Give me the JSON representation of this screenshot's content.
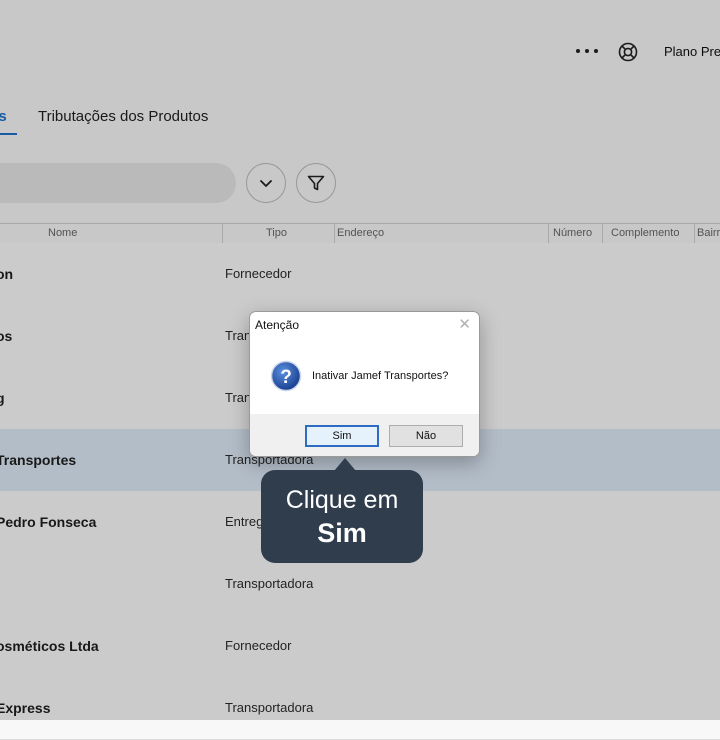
{
  "header": {
    "plan_label": "Plano Pre"
  },
  "tabs": [
    {
      "label": "es",
      "active": true
    },
    {
      "label": "Tributações dos Produtos",
      "active": false
    }
  ],
  "table": {
    "columns": [
      "Nome",
      "Tipo",
      "Endereço",
      "Número",
      "Complemento",
      "Bairr"
    ],
    "rows": [
      {
        "name": "on",
        "type": "Fornecedor",
        "selected": false
      },
      {
        "name": "os",
        "type": "Tran",
        "selected": false
      },
      {
        "name": "g",
        "type": "Tran",
        "selected": false
      },
      {
        "name": " Transportes",
        "type": "Transportadora",
        "selected": true
      },
      {
        "name": "Pedro Fonseca",
        "type": "Entreg",
        "selected": false
      },
      {
        "name": "",
        "type": "Transportadora",
        "selected": false
      },
      {
        "name": "osméticos Ltda",
        "type": "Fornecedor",
        "selected": false
      },
      {
        "name": "Express",
        "type": "Transportadora",
        "selected": false
      }
    ]
  },
  "dialog": {
    "title": "Atenção",
    "close_glyph": "✕",
    "message": "Inativar Jamef Transportes?",
    "yes_label": "Sim",
    "no_label": "Não"
  },
  "callout": {
    "line1": "Clique em",
    "line2": "Sim"
  },
  "colors": {
    "accent": "#1d6fc8",
    "selected_row": "#dbe7f4",
    "callout_bg": "#2f3d4d"
  },
  "icons": {
    "more": "more-horizontal-icon",
    "help": "lifebuoy-icon",
    "expand": "chevron-down-icon",
    "filter": "filter-icon",
    "question": "question-icon"
  }
}
